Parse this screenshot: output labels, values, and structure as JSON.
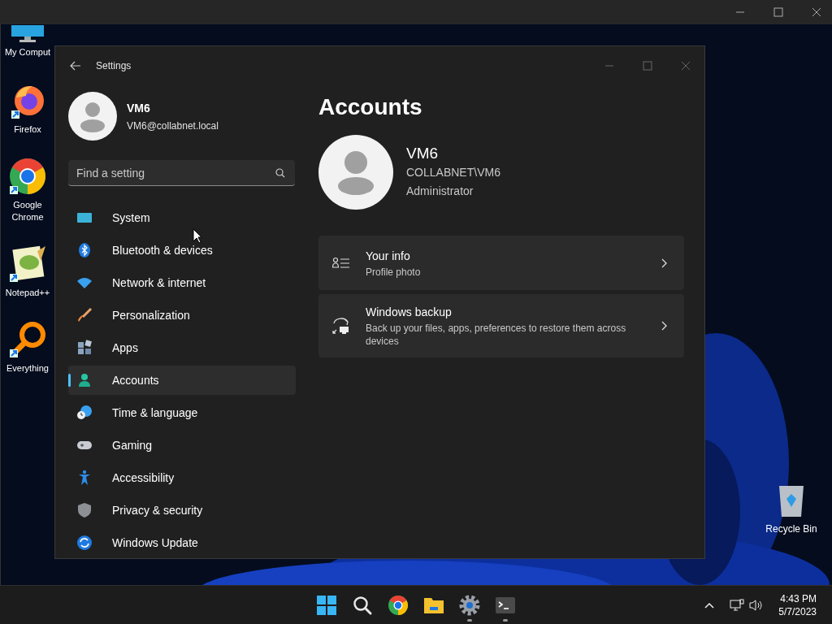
{
  "desktop_icons": [
    {
      "label": "My Comput",
      "kind": "monitor"
    },
    {
      "label": "Firefox",
      "kind": "firefox"
    },
    {
      "label": "Google Chrome",
      "kind": "chrome"
    },
    {
      "label": "Notepad++",
      "kind": "notepad"
    },
    {
      "label": "Everything",
      "kind": "everything"
    }
  ],
  "recycle_bin": {
    "label": "Recycle Bin"
  },
  "settings": {
    "title": "Settings",
    "user": {
      "name": "VM6",
      "email": "VM6@collabnet.local"
    },
    "search": {
      "placeholder": "Find a setting"
    },
    "nav": [
      {
        "label": "System",
        "kind": "system",
        "selected": false
      },
      {
        "label": "Bluetooth & devices",
        "kind": "bluetooth",
        "selected": false
      },
      {
        "label": "Network & internet",
        "kind": "network",
        "selected": false
      },
      {
        "label": "Personalization",
        "kind": "brush",
        "selected": false
      },
      {
        "label": "Apps",
        "kind": "apps",
        "selected": false
      },
      {
        "label": "Accounts",
        "kind": "accounts",
        "selected": true
      },
      {
        "label": "Time & language",
        "kind": "time",
        "selected": false
      },
      {
        "label": "Gaming",
        "kind": "gaming",
        "selected": false
      },
      {
        "label": "Accessibility",
        "kind": "accessibility",
        "selected": false
      },
      {
        "label": "Privacy & security",
        "kind": "privacy",
        "selected": false
      },
      {
        "label": "Windows Update",
        "kind": "update",
        "selected": false
      }
    ],
    "heading": "Accounts",
    "profile": {
      "name": "VM6",
      "account": "COLLABNET\\VM6",
      "role": "Administrator"
    },
    "cards": [
      {
        "title": "Your info",
        "subtitle": "Profile photo",
        "kind": "info"
      },
      {
        "title": "Windows backup",
        "subtitle": "Back up your files, apps, preferences to restore them across devices",
        "kind": "backup"
      }
    ]
  },
  "taskbar": {
    "apps": [
      {
        "kind": "start",
        "running": false
      },
      {
        "kind": "search",
        "running": false
      },
      {
        "kind": "chrome",
        "running": false
      },
      {
        "kind": "explorer",
        "running": false
      },
      {
        "kind": "settings",
        "running": true
      },
      {
        "kind": "terminal",
        "running": true
      }
    ],
    "time": "4:43 PM",
    "date": "5/7/2023"
  }
}
